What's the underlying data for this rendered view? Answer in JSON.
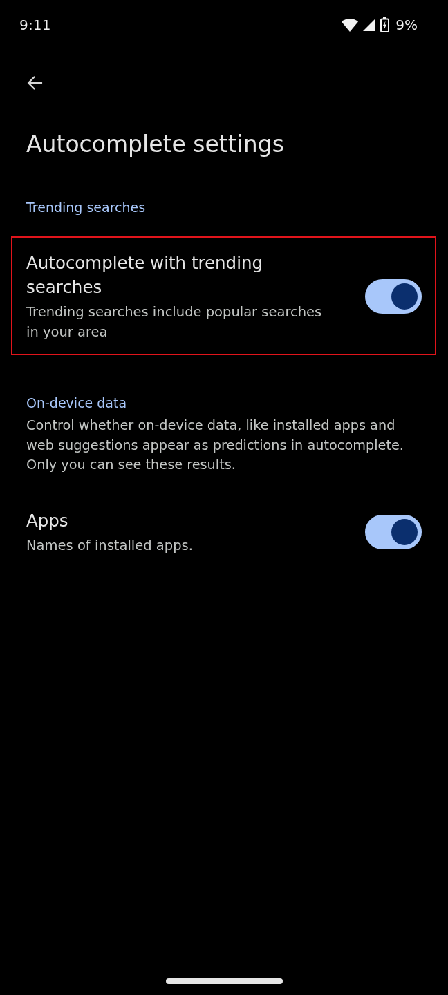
{
  "status_bar": {
    "time": "9:11",
    "battery": "9%"
  },
  "app_bar": {
    "title": "Autocomplete settings"
  },
  "sections": [
    {
      "header": "Trending searches",
      "settings": [
        {
          "title": "Autocomplete with trending searches",
          "summary": "Trending searches include popular searches in your area",
          "on": true,
          "highlighted": true
        }
      ]
    },
    {
      "header": "On-device data",
      "description": "Control whether on-device data, like installed apps and web suggestions appear as predictions in autocomplete. Only you can see these results.",
      "settings": [
        {
          "title": "Apps",
          "summary": "Names of installed apps.",
          "on": true,
          "highlighted": false
        }
      ]
    }
  ]
}
